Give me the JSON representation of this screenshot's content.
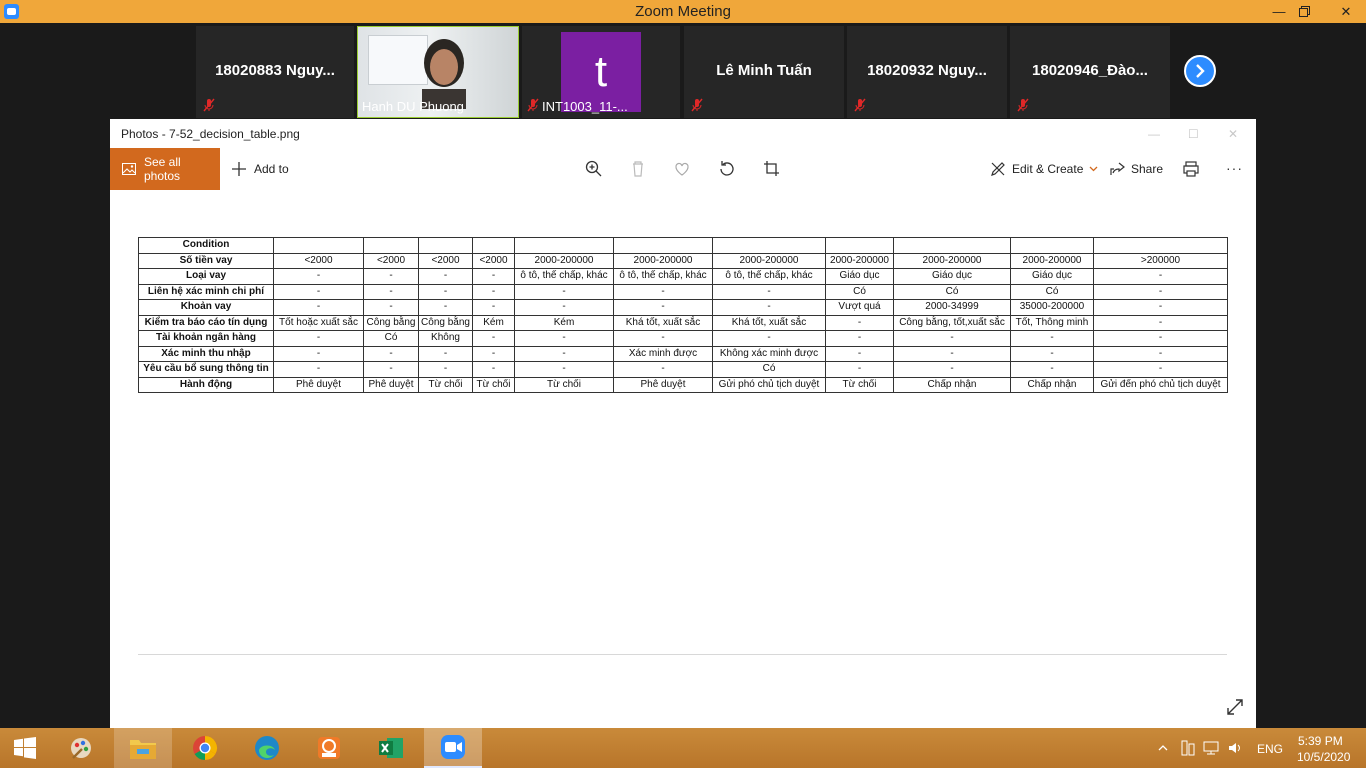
{
  "zoom": {
    "window_title": "Zoom Meeting",
    "participants": [
      {
        "name": "18020883 Nguy..."
      },
      {
        "name": "Hanh DU Phuong"
      },
      {
        "name": "INT1003_11-...",
        "avatar_letter": "t"
      },
      {
        "name": "Lê Minh Tuấn"
      },
      {
        "name": "18020932 Nguy..."
      },
      {
        "name": "18020946_Đào..."
      }
    ]
  },
  "photos": {
    "window_title": "Photos - 7-52_decision_table.png",
    "toolbar": {
      "see_all": "See all photos",
      "add_to": "Add to",
      "edit_create": "Edit & Create",
      "share": "Share",
      "more": "···"
    },
    "decision_table": {
      "rows": [
        {
          "label": "Condition",
          "cells": [
            "",
            "",
            "",
            "",
            "",
            "",
            "",
            "",
            "",
            "",
            ""
          ]
        },
        {
          "label": "Số tiền vay",
          "cells": [
            "<2000",
            "<2000",
            "<2000",
            "<2000",
            "2000-200000",
            "2000-200000",
            "2000-200000",
            "2000-200000",
            "2000-200000",
            "2000-200000",
            ">200000"
          ]
        },
        {
          "label": "Loại vay",
          "cells": [
            "-",
            "-",
            "-",
            "-",
            "ô tô, thế chấp, khác",
            "ô tô, thế chấp, khác",
            "ô tô, thế chấp, khác",
            "Giáo dục",
            "Giáo dục",
            "Giáo dục",
            "-"
          ]
        },
        {
          "label": "Liên hệ xác minh chi phí",
          "cells": [
            "-",
            "-",
            "-",
            "-",
            "-",
            "-",
            "-",
            "Có",
            "Có",
            "Có",
            "-"
          ]
        },
        {
          "label": "Khoản vay",
          "cells": [
            "-",
            "-",
            "-",
            "-",
            "-",
            "-",
            "-",
            "Vượt quá",
            "2000-34999",
            "35000-200000",
            "-"
          ]
        },
        {
          "label": "Kiểm tra báo cáo tín dụng",
          "cells": [
            "Tốt hoặc xuất sắc",
            "Công bằng",
            "Công bằng",
            "Kém",
            "Kém",
            "Khá tốt, xuất sắc",
            "Khá tốt, xuất sắc",
            "-",
            "Công bằng, tốt,xuất sắc",
            "Tốt, Thông minh",
            "-"
          ]
        },
        {
          "label": "Tài khoản ngân hàng",
          "cells": [
            "-",
            "Có",
            "Không",
            "-",
            "-",
            "-",
            "-",
            "-",
            "-",
            "-",
            "-"
          ]
        },
        {
          "label": "Xác minh thu nhập",
          "cells": [
            "-",
            "-",
            "-",
            "-",
            "-",
            "Xác minh được",
            "Không xác minh được",
            "-",
            "-",
            "-",
            "-"
          ]
        },
        {
          "label": "Yêu cầu bổ sung thông tin",
          "cells": [
            "-",
            "-",
            "-",
            "-",
            "-",
            "-",
            "Có",
            "-",
            "-",
            "-",
            "-"
          ]
        },
        {
          "label": "Hành động",
          "cells": [
            "Phê duyệt",
            "Phê duyệt",
            "Từ chối",
            "Từ chối",
            "Từ chối",
            "Phê duyệt",
            "Gửi phó chủ tịch duyệt",
            "Từ chối",
            "Chấp nhận",
            "Chấp nhận",
            "Gửi đến phó chủ tịch duyệt"
          ]
        }
      ]
    }
  },
  "taskbar": {
    "language": "ENG",
    "time": "5:39 PM",
    "date": "10/5/2020"
  }
}
